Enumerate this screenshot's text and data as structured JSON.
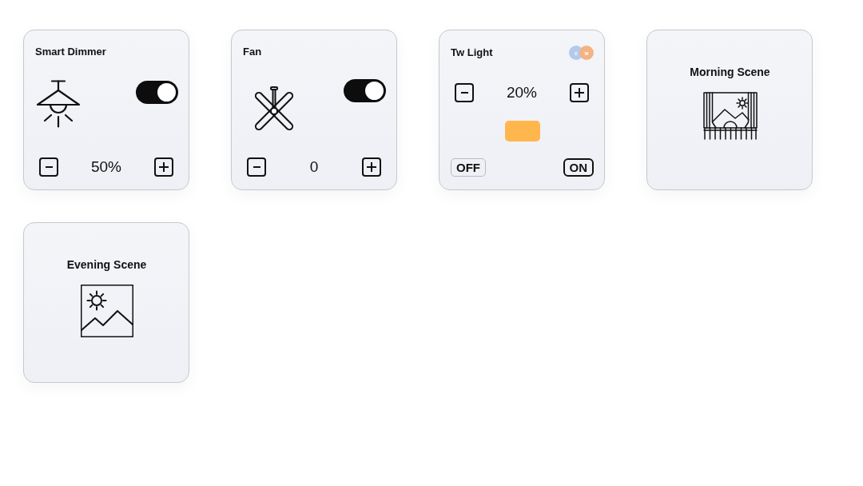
{
  "devices": [
    {
      "kind": "dimmer",
      "name": "Smart Dimmer",
      "on": true,
      "value": "50%"
    },
    {
      "kind": "fan",
      "name": "Fan",
      "on": true,
      "value": "0"
    },
    {
      "kind": "tunable",
      "name": "Tw Light",
      "badge": [
        "c",
        "w"
      ],
      "value": "20%",
      "color": "#ffb74d",
      "modes": [
        {
          "label": "OFF",
          "selected": false
        },
        {
          "label": "ON",
          "selected": true
        }
      ]
    }
  ],
  "scenes": [
    {
      "name": "Morning Scene"
    },
    {
      "name": "Evening Scene"
    }
  ]
}
